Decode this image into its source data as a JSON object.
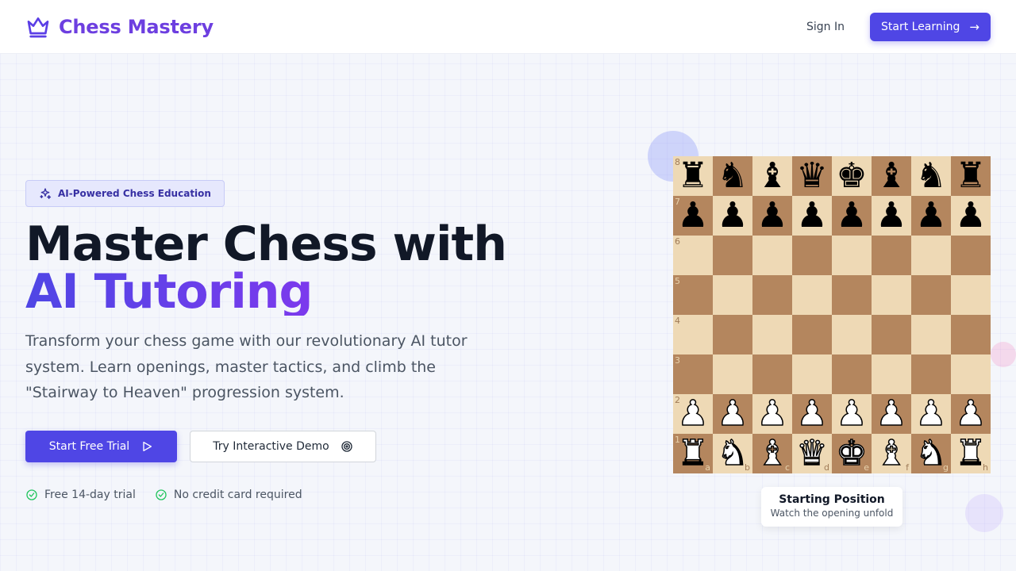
{
  "header": {
    "brand": "Chess Mastery",
    "brand_icon": "crown-icon",
    "sign_in": "Sign In",
    "cta": "Start Learning",
    "cta_icon": "arrow-right-icon"
  },
  "hero": {
    "badge": "AI-Powered Chess Education",
    "badge_icon": "sparkles-icon",
    "title_line1": "Master Chess with",
    "title_line2": "AI Tutoring",
    "description": "Transform your chess game with our revolutionary AI tutor system. Learn openings, master tactics, and climb the \"Stairway to Heaven\" progression system.",
    "primary_button": "Start Free Trial",
    "primary_icon": "play-icon",
    "secondary_button": "Try Interactive Demo",
    "secondary_icon": "target-icon",
    "perks": [
      "Free 14-day trial",
      "No credit card required"
    ],
    "perk_icon": "check-circle-icon"
  },
  "board": {
    "ranks": [
      "8",
      "7",
      "6",
      "5",
      "4",
      "3",
      "2",
      "1"
    ],
    "files": [
      "a",
      "b",
      "c",
      "d",
      "e",
      "f",
      "g",
      "h"
    ],
    "position": [
      [
        "bR",
        "bN",
        "bB",
        "bQ",
        "bK",
        "bB",
        "bN",
        "bR"
      ],
      [
        "bP",
        "bP",
        "bP",
        "bP",
        "bP",
        "bP",
        "bP",
        "bP"
      ],
      [
        "",
        "",
        "",
        "",
        "",
        "",
        "",
        ""
      ],
      [
        "",
        "",
        "",
        "",
        "",
        "",
        "",
        ""
      ],
      [
        "",
        "",
        "",
        "",
        "",
        "",
        "",
        ""
      ],
      [
        "",
        "",
        "",
        "",
        "",
        "",
        "",
        ""
      ],
      [
        "wP",
        "wP",
        "wP",
        "wP",
        "wP",
        "wP",
        "wP",
        "wP"
      ],
      [
        "wR",
        "wN",
        "wB",
        "wQ",
        "wK",
        "wB",
        "wN",
        "wR"
      ]
    ],
    "caption_title": "Starting Position",
    "caption_subtitle": "Watch the opening unfold"
  },
  "colors": {
    "accent": "#4f46e5",
    "brand": "#6d3fe0",
    "light_square": "#eed9b5",
    "dark_square": "#b4865e",
    "check": "#22c55e"
  }
}
